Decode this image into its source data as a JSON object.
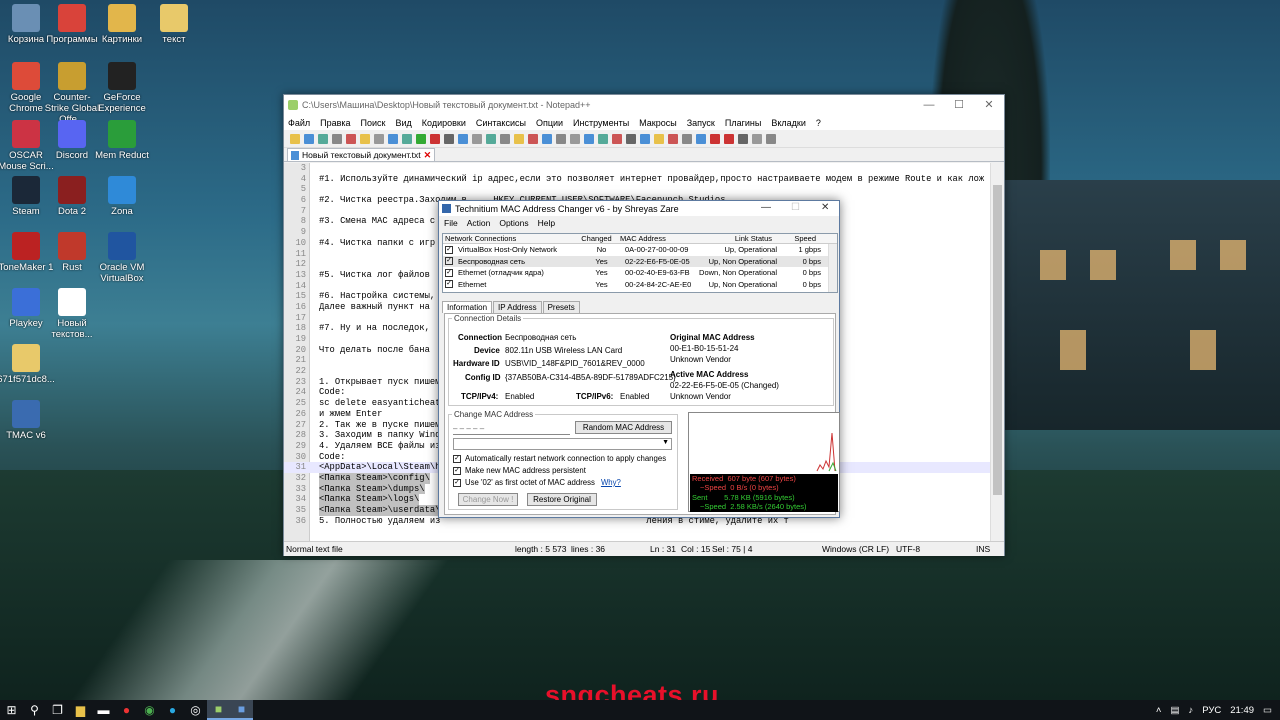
{
  "desktop_icons": [
    {
      "label": "Корзина",
      "icon": "recycle-bin",
      "color": "#6a8fb4"
    },
    {
      "label": "Программы",
      "icon": "folder",
      "color": "#d9433a"
    },
    {
      "label": "Картинки",
      "icon": "folder",
      "color": "#e2b64b"
    },
    {
      "label": "текст",
      "icon": "folder",
      "color": "#e8c96a"
    },
    {
      "label": "Google Chrome",
      "icon": "chrome",
      "color": "#dd4b39"
    },
    {
      "label": "Counter-Strike Global Offe...",
      "icon": "csgo",
      "color": "#c89e30"
    },
    {
      "label": "GeForce Experience",
      "icon": "nvidia",
      "color": "#222"
    },
    {
      "label": "OSCAR Mouse Scri...",
      "icon": "mouse",
      "color": "#c34"
    },
    {
      "label": "Discord",
      "icon": "discord",
      "color": "#5865f2"
    },
    {
      "label": "Mem Reduct",
      "icon": "memory",
      "color": "#2a9d3a"
    },
    {
      "label": "Steam",
      "icon": "steam",
      "color": "#1b2838"
    },
    {
      "label": "Dota 2",
      "icon": "dota",
      "color": "#8a1f1f"
    },
    {
      "label": "Zona",
      "icon": "zona",
      "color": "#2f8ad8"
    },
    {
      "label": "ToneMaker 1",
      "icon": "tone",
      "color": "#b22"
    },
    {
      "label": "Rust",
      "icon": "rust",
      "color": "#c0392b"
    },
    {
      "label": "Oracle VM VirtualBox",
      "icon": "vbox",
      "color": "#2055a0"
    },
    {
      "label": "Playkey",
      "icon": "playkey",
      "color": "#3b6fd8"
    },
    {
      "label": "Новый текстов...",
      "icon": "text-file",
      "color": "#fff"
    },
    {
      "label": "671f571dc8...",
      "icon": "folder",
      "color": "#e8c96a"
    },
    {
      "label": "TMAC v6",
      "icon": "tmac",
      "color": "#3a6bb0"
    }
  ],
  "notepadpp": {
    "title": "C:\\Users\\Машина\\Desktop\\Новый текстовый документ.txt - Notepad++",
    "menu": [
      "Файл",
      "Правка",
      "Поиск",
      "Вид",
      "Кодировки",
      "Синтаксисы",
      "Опции",
      "Инструменты",
      "Макросы",
      "Запуск",
      "Плагины",
      "Вкладки",
      "?"
    ],
    "tab": "Новый текстовый документ.txt",
    "lines": [
      {
        "n": "3",
        "t": ""
      },
      {
        "n": "4",
        "t": "#1. Используйте динамический ip адрес,если это позволяет интернет провайдер,просто настраиваете модем в режиме Route и как лож"
      },
      {
        "n": "5",
        "t": ""
      },
      {
        "n": "6",
        "t": "#2. Чистка реестра.Заходим в ... HKEY_CURRENT_USER\\SOFTWARE\\Facepunch Studios"
      },
      {
        "n": "7",
        "t": ""
      },
      {
        "n": "8",
        "t": "#3. Смена MAC адреса с                                        открываем, открывается простое"
      },
      {
        "n": "9",
        "t": ""
      },
      {
        "n": "10",
        "t": "#4. Чистка папки с игр                                        датой,тех самых краш репорт"
      },
      {
        "n": "11",
        "t": ""
      },
      {
        "n": "12",
        "t": ""
      },
      {
        "n": "13",
        "t": "#5. Чистка лог файлов                                         .vdf и loginusers.vdf,я обыч"
      },
      {
        "n": "14",
        "t": ""
      },
      {
        "n": "15",
        "t": "#6. Настройка системы,                                        ключен UAC."
      },
      {
        "n": "16",
        "t": "Далее важный пункт на                                         вваем Пуск или Поиск пишем"
      },
      {
        "n": "17",
        "t": ""
      },
      {
        "n": "18",
        "t": "#7. Ну и на последок,                                         программой CCleaner это повы"
      },
      {
        "n": "19",
        "t": ""
      },
      {
        "n": "20",
        "t": "Что делать после бана"
      },
      {
        "n": "21",
        "t": ""
      },
      {
        "n": "22",
        "t": ""
      },
      {
        "n": "23",
        "t": "1. Открывает пуск пишем"
      },
      {
        "n": "24",
        "t": "Code:"
      },
      {
        "n": "25",
        "t": "sc delete easyanticheat"
      },
      {
        "n": "26",
        "t": "и жмем Enter"
      },
      {
        "n": "27",
        "t": "2. Так же в пуске пишем                                       т и удаляем то, что нашло."
      },
      {
        "n": "28",
        "t": "3. Заходим в папку Wind                                       ем."
      },
      {
        "n": "29",
        "t": "4. Удаляем ВСЕ файлы из"
      },
      {
        "n": "30",
        "t": "Code:"
      },
      {
        "n": "31",
        "t": "<AppData>\\Local\\Steam\\h"
      },
      {
        "n": "32",
        "t": "<Папка Steam>\\config\\"
      },
      {
        "n": "33",
        "t": "<Папка Steam>\\dumps\\"
      },
      {
        "n": "34",
        "t": "<Папка Steam>\\logs\\"
      },
      {
        "n": "35",
        "t": "<Папка Steam>\\userdata\\"
      },
      {
        "n": "36",
        "t": "5. Полностью удаляем из                                       ления в стиме, удалите их т"
      }
    ],
    "status": {
      "type": "Normal text file",
      "length": "length : 5 573",
      "lines": "lines : 36",
      "ln": "Ln : 31",
      "col": "Col : 15",
      "sel": "Sel : 75 | 4",
      "eol": "Windows (CR LF)",
      "enc": "UTF-8",
      "ins": "INS"
    }
  },
  "tmac": {
    "title": "Technitium MAC Address Changer v6 - by Shreyas Zare",
    "menu": [
      "File",
      "Action",
      "Options",
      "Help"
    ],
    "columns": [
      "Network Connections",
      "Changed",
      "MAC Address",
      "Link Status",
      "Speed"
    ],
    "rows": [
      {
        "name": "VirtualBox Host-Only Network",
        "changed": "No",
        "mac": "0A-00-27-00-00-09",
        "status": "Up, Operational",
        "speed": "1 gbps"
      },
      {
        "name": "Беспроводная сеть",
        "changed": "Yes",
        "mac": "02-22-E6-F5-0E-05",
        "status": "Up, Non Operational",
        "speed": "0 bps"
      },
      {
        "name": "Ethernet (отладчик ядра)",
        "changed": "Yes",
        "mac": "00-02-40-E9-63-FB",
        "status": "Down, Non Operational",
        "speed": "0 bps"
      },
      {
        "name": "Ethernet",
        "changed": "Yes",
        "mac": "00-24-84-2C-AE-E0",
        "status": "Up, Non Operational",
        "speed": "0 bps"
      }
    ],
    "tabs": [
      "Information",
      "IP Address",
      "Presets"
    ],
    "details_legend": "Connection Details",
    "connection_label": "Connection",
    "connection": "Беспроводная сеть",
    "device_label": "Device",
    "device": "802.11n USB Wireless LAN Card",
    "hwid_label": "Hardware ID",
    "hwid": "USB\\VID_148F&PID_7601&REV_0000",
    "cfgid_label": "Config ID",
    "cfgid": "{37AB50BA-C314-4B5A-89DF-51789ADFC215}",
    "ipv4_label": "TCP/IPv4:",
    "ipv4": "Enabled",
    "ipv6_label": "TCP/IPv6:",
    "ipv6": "Enabled",
    "orig_mac_label": "Original MAC Address",
    "orig_mac": "00-E1-B0-15-51-24",
    "orig_vendor": "Unknown Vendor",
    "active_mac_label": "Active MAC Address",
    "active_mac": "02-22-E6-F5-0E-05 (Changed)",
    "active_vendor": "Unknown Vendor",
    "change_legend": "Change MAC Address",
    "mac_input": "–  –  –  –  –",
    "random_btn": "Random MAC Address",
    "opt1": "Automatically restart network connection to apply changes",
    "opt2": "Make new MAC address persistent",
    "opt3": "Use '02' as first octet of MAC address",
    "why": "Why?",
    "change_btn": "Change Now !",
    "restore_btn": "Restore Original",
    "stats": {
      "received_label": "Received",
      "received": "607 byte (607 bytes)",
      "rspeed_label": "~Speed",
      "rspeed": "0 B/s (0 bytes)",
      "sent_label": "Sent",
      "sent": "5.78 KB (5916 bytes)",
      "sspeed_label": "~Speed",
      "sspeed": "2.58 KB/s (2640 bytes)"
    }
  },
  "taskbar": {
    "lang": "РУС",
    "time": "21:49"
  },
  "watermark": "sngcheats.ru"
}
